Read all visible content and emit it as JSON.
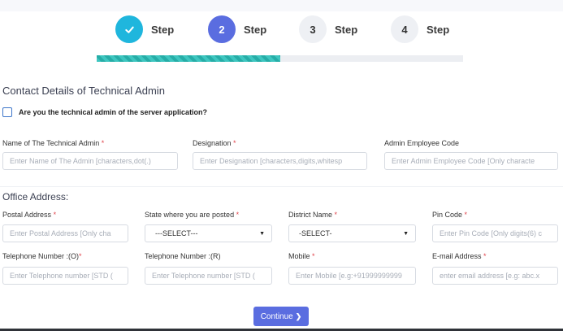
{
  "stepper": {
    "steps": [
      {
        "number": "",
        "label": "Step",
        "state": "completed",
        "icon": "check-icon",
        "color": "#1fb6dd"
      },
      {
        "number": "2",
        "label": "Step",
        "state": "active",
        "color": "#5a6de0"
      },
      {
        "number": "3",
        "label": "Step",
        "state": "pending",
        "color": "#eef0f4"
      },
      {
        "number": "4",
        "label": "Step",
        "state": "pending",
        "color": "#eef0f4"
      }
    ],
    "progress_fraction": 0.5
  },
  "section_title": "Contact Details of Technical Admin",
  "checkbox": {
    "label": "Are you the technical admin of the server application?",
    "checked": false
  },
  "admin": {
    "name_label": "Name of The Technical Admin",
    "name_placeholder": "Enter Name of The Admin [characters,dot(.)",
    "designation_label": "Designation",
    "designation_placeholder": "Enter Designation [characters,digits,whitesp",
    "code_label": "Admin Employee Code",
    "code_placeholder": "Enter Admin Employee Code [Only characte"
  },
  "office": {
    "title": "Office Address:",
    "postal_label": "Postal Address",
    "postal_placeholder": "Enter Postal Address [Only cha",
    "state_label": "State where you are posted",
    "state_value": "---SELECT---",
    "district_label": "District Name",
    "district_value": "-SELECT-",
    "pin_label": "Pin Code",
    "pin_placeholder": "Enter Pin Code [Only digits(6) c",
    "tel_o_label": "Telephone Number :(O)",
    "tel_o_placeholder": "Enter Telephone number [STD (",
    "tel_r_label": "Telephone Number :(R)",
    "tel_r_placeholder": "Enter Telephone number [STD (",
    "mobile_label": "Mobile",
    "mobile_placeholder": "Enter Mobile [e.g:+91999999999",
    "email_label": "E-mail Address",
    "email_placeholder": "enter email address [e.g: abc.x"
  },
  "required_marker": "*",
  "continue_label": "Continue",
  "colors": {
    "accent": "#5a6de0",
    "completed": "#1fb6dd",
    "progress": "#3ec6c0",
    "required": "#e0454c"
  }
}
